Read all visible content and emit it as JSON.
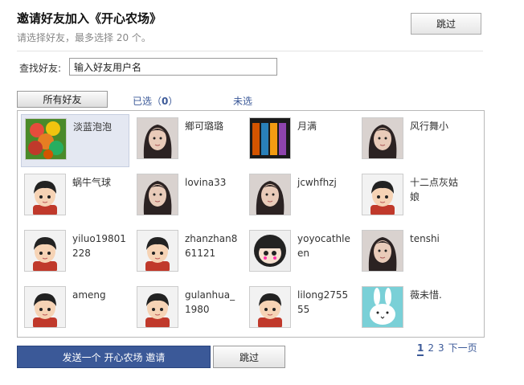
{
  "header": {
    "title": "邀请好友加入《开心农场》",
    "subtitle": "请选择好友，最多选择  20 个。",
    "skip_label": "跳过"
  },
  "search": {
    "label": "查找好友:",
    "value": "输入好友用户名"
  },
  "tabs": {
    "all_label": "所有好友",
    "selected_prefix": "已选（",
    "selected_count": "0",
    "selected_suffix": "）",
    "unselected_label": "未选"
  },
  "friends": [
    {
      "name": "淡蓝泡泡",
      "avatar": "fruit-photo"
    },
    {
      "name": "鄉可璐璐",
      "avatar": "girl-photo"
    },
    {
      "name": "月满",
      "avatar": "art-photo"
    },
    {
      "name": "风行舞小",
      "avatar": "girl-photo"
    },
    {
      "name": "蜗牛气球",
      "avatar": "default-cartoon"
    },
    {
      "name": "lovina33",
      "avatar": "girl-photo"
    },
    {
      "name": "jcwhfhzj",
      "avatar": "girl-photo"
    },
    {
      "name": "十二点灰姑娘",
      "avatar": "default-cartoon"
    },
    {
      "name": "yiluo19801228",
      "avatar": "default-cartoon"
    },
    {
      "name": "zhanzhan861121",
      "avatar": "default-cartoon"
    },
    {
      "name": "yoyocathleen",
      "avatar": "cartoon-girl"
    },
    {
      "name": "tenshi",
      "avatar": "girl-photo"
    },
    {
      "name": "ameng",
      "avatar": "default-cartoon"
    },
    {
      "name": "gulanhua_1980",
      "avatar": "default-cartoon"
    },
    {
      "name": "lilong275555",
      "avatar": "default-cartoon"
    },
    {
      "name": "薇未惜.",
      "avatar": "bunny-cartoon"
    }
  ],
  "footer": {
    "send_label": "发送一个  开心农场  邀请",
    "skip_label": "跳过",
    "pages": [
      "1",
      "2",
      "3"
    ],
    "current_page": "1",
    "next_label": "下一页"
  },
  "colors": {
    "accent": "#3b5998",
    "selected_bg": "#e4e8f2"
  }
}
